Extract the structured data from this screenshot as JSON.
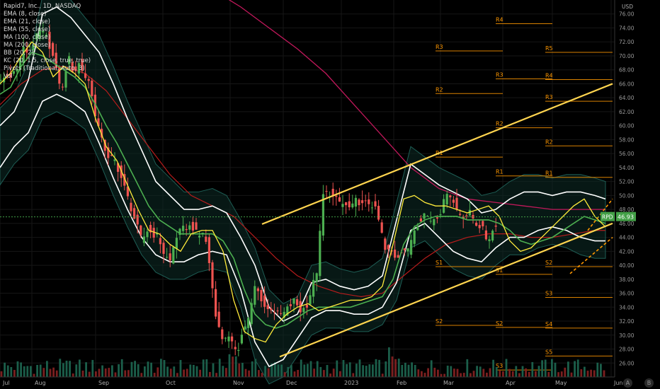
{
  "legend": [
    "Rapid7, Inc., 1D, NASDAQ",
    "EMA (8, close)",
    "EMA (21, close)",
    "EMA (55, close)",
    "MA (100, close)",
    "MA (200, close)",
    "BB (20, 2)",
    "KC (20, 1.5, close, true, true)",
    "Pivots (Traditional, Auto, 3)",
    "Vol"
  ],
  "colors": {
    "up": "#26a69a",
    "up_bright": "#4caf50",
    "down": "#ef5350",
    "ema8": "#ffeb3b",
    "ema21": "#4caf50",
    "ema55": "#b71c1c",
    "ma200": "#c2185b",
    "bands": "#ffffff",
    "keltner_fill": "#0d2b27",
    "trendline": "#ffd54f",
    "pivot": "#ff9800",
    "price_tag": "#43a047"
  },
  "buttons": {
    "a": "A",
    "b": "B"
  },
  "chart_data": {
    "type": "candlestick",
    "title": "Rapid7, Inc., 1D, NASDAQ",
    "ticker": "RPD",
    "last_price": 46.93,
    "price_unit": "USD",
    "ylim": [
      24.0,
      78.0
    ],
    "y_ticks": [
      "26.00",
      "28.00",
      "30.00",
      "32.00",
      "34.00",
      "36.00",
      "38.00",
      "40.00",
      "42.00",
      "44.00",
      "46.00",
      "48.00",
      "50.00",
      "52.00",
      "54.00",
      "56.00",
      "58.00",
      "60.00",
      "62.00",
      "64.00",
      "66.00",
      "68.00",
      "70.00",
      "72.00",
      "74.00",
      "76.00"
    ],
    "x_ticks": [
      "Jul",
      "Aug",
      "Sep",
      "Oct",
      "Nov",
      "Dec",
      "2023",
      "Feb",
      "Mar",
      "Apr",
      "May",
      "Jun"
    ],
    "x_tick_days": [
      0,
      45,
      135,
      230,
      325,
      400,
      482,
      556,
      622,
      710,
      780,
      863
    ],
    "series": [
      {
        "name": "Close",
        "days": [
          0,
          8,
          16,
          24,
          32,
          40,
          48,
          56,
          64,
          72,
          80,
          88,
          96,
          104,
          112,
          120,
          128,
          136,
          144,
          152,
          160,
          168,
          176,
          184,
          192,
          200,
          208,
          216,
          224,
          232,
          240,
          248,
          256,
          264,
          272,
          280,
          288,
          296,
          304,
          312,
          320,
          328,
          336,
          344,
          352,
          360,
          368,
          376,
          384,
          392,
          400,
          408,
          416,
          424,
          432,
          440,
          448,
          456,
          464,
          472,
          480,
          488,
          496,
          504,
          512,
          520,
          528,
          536,
          544,
          552,
          560,
          568,
          576,
          584,
          592,
          600,
          608,
          616,
          624,
          632,
          640,
          648,
          656,
          664,
          672,
          680,
          688,
          696,
          704,
          712,
          720,
          728,
          736,
          744,
          752,
          760,
          768,
          776,
          784,
          792,
          800,
          808,
          816,
          824,
          832,
          840,
          848
        ],
        "values": [
          66.5,
          67.0,
          67.5,
          68.0,
          71.0,
          70.5,
          72.0,
          73.5,
          73.0,
          71.0,
          67.5,
          65.0,
          70.0,
          67.5,
          69.0,
          67.0,
          66.0,
          60.0,
          58.5,
          55.0,
          55.5,
          53.5,
          51.0,
          48.5,
          46.0,
          43.5,
          45.0,
          44.5,
          44.0,
          41.5,
          40.5,
          44.0,
          45.0,
          45.5,
          45.5,
          44.0,
          45.0,
          40.0,
          33.5,
          29.5,
          30.0,
          28.5,
          28.0,
          31.0,
          32.5,
          37.0,
          35.5,
          33.5,
          34.0,
          33.0,
          33.0,
          34.0,
          35.0,
          33.5,
          34.0,
          36.5,
          39.5,
          50.0,
          50.5,
          49.5,
          49.0,
          48.5,
          48.0,
          49.5,
          48.5,
          49.0,
          48.5,
          46.0,
          42.0,
          42.0,
          41.0,
          42.5,
          42.0,
          45.0,
          46.5,
          47.5,
          46.5,
          47.0,
          48.0,
          51.0,
          49.0,
          47.5,
          47.0,
          47.5,
          46.0,
          45.5,
          43.5,
          45.0,
          46.93
        ]
      }
    ],
    "indicators": {
      "ema8": {
        "name": "EMA (8, close)",
        "days": [
          0,
          15,
          30,
          45,
          60,
          75,
          90,
          105,
          120,
          135,
          150,
          165,
          180,
          195,
          210,
          225,
          240,
          255,
          270,
          285,
          300,
          315,
          330,
          345,
          360,
          375,
          390,
          405,
          420,
          435,
          450,
          465,
          480,
          495,
          510,
          525,
          540,
          555,
          570,
          585,
          600,
          615,
          630,
          645,
          660,
          675,
          690,
          705,
          720,
          735,
          750,
          765,
          780,
          795,
          810,
          825,
          840,
          855
        ],
        "values": [
          66.0,
          67.5,
          70.0,
          72.0,
          70.5,
          67.0,
          68.5,
          67.5,
          66.0,
          61.0,
          57.0,
          55.0,
          51.5,
          48.0,
          45.0,
          44.5,
          43.0,
          42.0,
          44.5,
          45.0,
          45.0,
          42.0,
          35.0,
          30.5,
          29.5,
          29.0,
          31.5,
          33.0,
          34.0,
          34.5,
          33.5,
          34.0,
          34.5,
          35.0,
          35.0,
          35.5,
          37.0,
          43.0,
          49.5,
          50.0,
          49.0,
          48.5,
          48.5,
          48.0,
          47.5,
          48.0,
          48.5,
          47.0,
          43.5,
          42.0,
          42.5,
          44.0,
          45.5,
          47.0,
          48.5,
          49.5,
          47.0,
          45.5
        ]
      },
      "ema21": {
        "name": "EMA (21, close)",
        "days": [
          0,
          15,
          30,
          45,
          60,
          75,
          90,
          105,
          120,
          135,
          150,
          165,
          180,
          195,
          210,
          225,
          240,
          255,
          270,
          285,
          300,
          315,
          330,
          345,
          360,
          375,
          390,
          405,
          420,
          435,
          450,
          465,
          480,
          495,
          510,
          525,
          540,
          555,
          570,
          585,
          600,
          615,
          630,
          645,
          660,
          675,
          690,
          705,
          720,
          735,
          750,
          765,
          780,
          795,
          810,
          825,
          840,
          855
        ],
        "values": [
          64.5,
          65.5,
          68.5,
          70.5,
          70.0,
          69.0,
          68.0,
          67.0,
          65.5,
          63.0,
          60.0,
          57.5,
          54.5,
          51.5,
          48.5,
          46.5,
          45.5,
          44.5,
          44.5,
          44.5,
          44.5,
          43.5,
          41.0,
          36.5,
          33.0,
          31.5,
          31.0,
          31.5,
          32.5,
          33.5,
          34.0,
          34.0,
          34.0,
          34.0,
          34.5,
          35.0,
          35.5,
          38.0,
          43.0,
          45.5,
          46.5,
          47.0,
          47.0,
          47.0,
          46.5,
          46.5,
          46.5,
          46.0,
          45.0,
          43.5,
          43.0,
          43.5,
          44.0,
          45.0,
          46.0,
          47.0,
          46.5,
          46.0
        ]
      },
      "ema55": {
        "name": "EMA (55, close)",
        "days": [
          0,
          30,
          60,
          90,
          120,
          150,
          180,
          210,
          240,
          270,
          300,
          330,
          360,
          390,
          420,
          450,
          480,
          510,
          540,
          570,
          600,
          630,
          660,
          690,
          720,
          750,
          780,
          810,
          840,
          855
        ],
        "values": [
          63.0,
          66.0,
          68.0,
          68.5,
          67.5,
          65.0,
          61.0,
          57.0,
          53.0,
          50.0,
          48.5,
          47.0,
          44.0,
          41.0,
          38.5,
          37.0,
          36.0,
          35.5,
          36.0,
          38.5,
          41.0,
          43.0,
          44.0,
          44.5,
          44.5,
          44.0,
          44.0,
          44.5,
          45.0,
          45.0
        ]
      },
      "ma200": {
        "name": "MA (200, close)",
        "days": [
          300,
          340,
          380,
          420,
          460,
          500,
          540,
          580,
          620,
          660,
          700,
          740,
          780,
          820,
          855
        ],
        "values": [
          79.5,
          77.0,
          74.0,
          71.0,
          67.5,
          63.0,
          58.5,
          54.0,
          51.0,
          49.5,
          49.0,
          48.5,
          48.0,
          48.0,
          48.0
        ]
      },
      "bb_upper": {
        "name": "BB upper",
        "days": [
          0,
          20,
          40,
          60,
          80,
          100,
          120,
          140,
          160,
          180,
          200,
          220,
          240,
          260,
          280,
          300,
          320,
          340,
          360,
          380,
          400,
          420,
          440,
          460,
          480,
          500,
          520,
          540,
          560,
          580,
          600,
          620,
          640,
          660,
          680,
          700,
          720,
          740,
          760,
          780,
          800,
          820,
          840,
          855
        ],
        "values": [
          60.0,
          62.0,
          66.5,
          76.0,
          77.0,
          75.5,
          73.0,
          70.5,
          66.0,
          61.0,
          56.5,
          52.0,
          50.0,
          48.0,
          48.0,
          48.5,
          47.5,
          44.0,
          40.0,
          34.0,
          32.0,
          33.0,
          37.5,
          38.0,
          37.0,
          36.5,
          37.0,
          38.5,
          46.5,
          54.5,
          53.0,
          51.5,
          50.5,
          49.5,
          47.5,
          48.0,
          49.5,
          50.5,
          50.5,
          50.0,
          50.5,
          50.5,
          50.0,
          49.5
        ]
      },
      "bb_lower": {
        "name": "BB lower",
        "days": [
          0,
          20,
          40,
          60,
          80,
          100,
          120,
          140,
          160,
          180,
          200,
          220,
          240,
          260,
          280,
          300,
          320,
          340,
          360,
          380,
          400,
          420,
          440,
          460,
          480,
          500,
          520,
          540,
          560,
          580,
          600,
          620,
          640,
          660,
          680,
          700,
          720,
          740,
          760,
          780,
          800,
          820,
          840,
          855
        ],
        "values": [
          54.0,
          57.0,
          59.0,
          63.5,
          64.5,
          63.5,
          62.0,
          57.5,
          52.5,
          48.0,
          44.0,
          41.5,
          40.5,
          40.5,
          41.5,
          42.0,
          41.5,
          36.5,
          29.0,
          25.5,
          26.5,
          29.5,
          32.5,
          33.5,
          33.5,
          33.0,
          33.0,
          34.0,
          37.5,
          45.0,
          46.0,
          44.0,
          42.0,
          41.0,
          40.5,
          42.5,
          44.0,
          44.0,
          45.0,
          45.5,
          45.0,
          44.0,
          43.5,
          43.5
        ]
      },
      "trendline_upper": {
        "name": "Channel upper",
        "days": [
          370,
          865
        ],
        "values": [
          45.9,
          66.0
        ]
      },
      "trendline_lower": {
        "name": "Channel lower",
        "days": [
          395,
          865
        ],
        "values": [
          26.9,
          46.0
        ]
      }
    },
    "pivots": [
      {
        "label": "R4",
        "value": 74.6,
        "from": 700,
        "to": 780
      },
      {
        "label": "R3",
        "value": 70.7,
        "from": 615,
        "to": 710
      },
      {
        "label": "R5",
        "value": 70.5,
        "from": 770,
        "to": 865
      },
      {
        "label": "R3",
        "value": 66.7,
        "from": 700,
        "to": 780
      },
      {
        "label": "R4",
        "value": 66.6,
        "from": 770,
        "to": 865
      },
      {
        "label": "R2",
        "value": 64.6,
        "from": 615,
        "to": 710
      },
      {
        "label": "R3",
        "value": 63.5,
        "from": 770,
        "to": 865
      },
      {
        "label": "R2",
        "value": 59.7,
        "from": 700,
        "to": 780
      },
      {
        "label": "R2",
        "value": 57.1,
        "from": 770,
        "to": 865
      },
      {
        "label": "R1",
        "value": 55.5,
        "from": 615,
        "to": 710
      },
      {
        "label": "R1",
        "value": 52.8,
        "from": 700,
        "to": 780
      },
      {
        "label": "R1",
        "value": 52.6,
        "from": 770,
        "to": 865
      },
      {
        "label": "S1",
        "value": 39.8,
        "from": 615,
        "to": 710
      },
      {
        "label": "S2",
        "value": 39.8,
        "from": 770,
        "to": 865
      },
      {
        "label": "S1",
        "value": 38.7,
        "from": 700,
        "to": 780
      },
      {
        "label": "S3",
        "value": 35.4,
        "from": 770,
        "to": 865
      },
      {
        "label": "S2",
        "value": 31.4,
        "from": 615,
        "to": 710
      },
      {
        "label": "S2",
        "value": 31.1,
        "from": 700,
        "to": 780
      },
      {
        "label": "S4",
        "value": 31.0,
        "from": 770,
        "to": 865
      },
      {
        "label": "S5",
        "value": 27.0,
        "from": 770,
        "to": 865
      },
      {
        "label": "S3",
        "value": 25.0,
        "from": 700,
        "to": 780
      }
    ],
    "grid": true,
    "legend_position": "top-left"
  }
}
